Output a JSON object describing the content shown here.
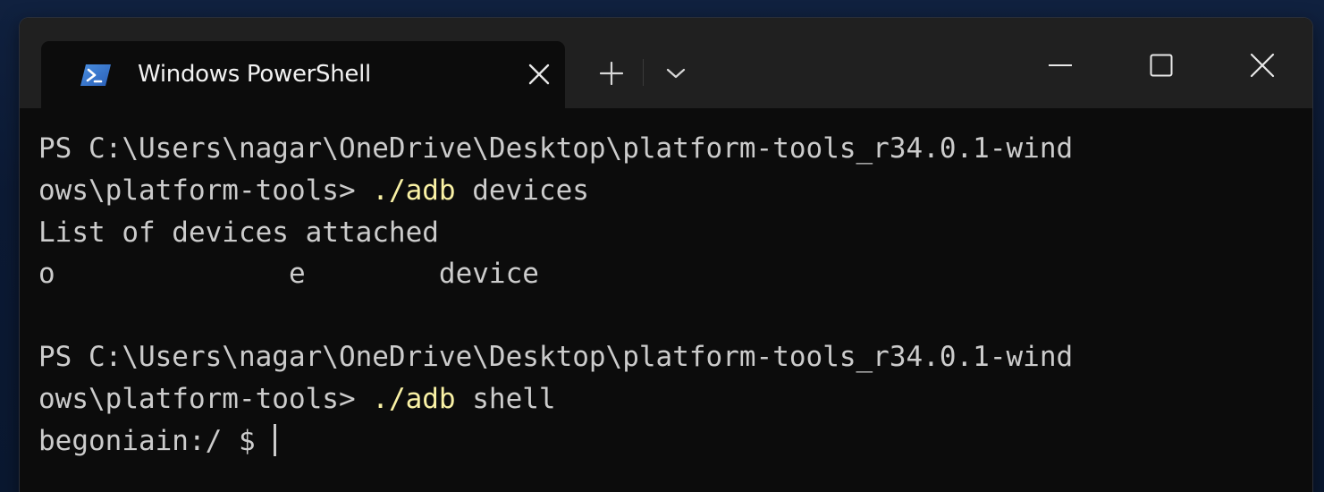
{
  "window": {
    "tab": {
      "title": "Windows PowerShell",
      "icon": "powershell-icon"
    },
    "controls": {
      "new_tab_icon": "plus-icon",
      "dropdown_icon": "chevron-down-icon",
      "minimize_icon": "minimize-icon",
      "maximize_icon": "maximize-icon",
      "close_icon": "close-icon"
    }
  },
  "colors": {
    "terminal_background": "#0c0c0c",
    "titlebar_background": "#202020",
    "text": "#cccccc",
    "command_text": "#f9f1a5",
    "desktop_background": "#0c1a34"
  },
  "terminal": {
    "lines": [
      {
        "prompt": "PS C:\\Users\\nagar\\OneDrive\\Desktop\\platform-tools_r34.0.1-wind",
        "command": "",
        "args": ""
      },
      {
        "prompt": "ows\\platform-tools> ",
        "command": "./adb",
        "args": " devices"
      },
      {
        "prompt": "List of devices attached",
        "command": "",
        "args": ""
      },
      {
        "prompt": "o              e        device",
        "command": "",
        "args": ""
      },
      {
        "prompt": "PS C:\\Users\\nagar\\OneDrive\\Desktop\\platform-tools_r34.0.1-wind",
        "command": "",
        "args": ""
      },
      {
        "prompt": "ows\\platform-tools> ",
        "command": "./adb",
        "args": " shell"
      },
      {
        "prompt": "begoniain:/ $ ",
        "command": "",
        "args": ""
      }
    ]
  }
}
